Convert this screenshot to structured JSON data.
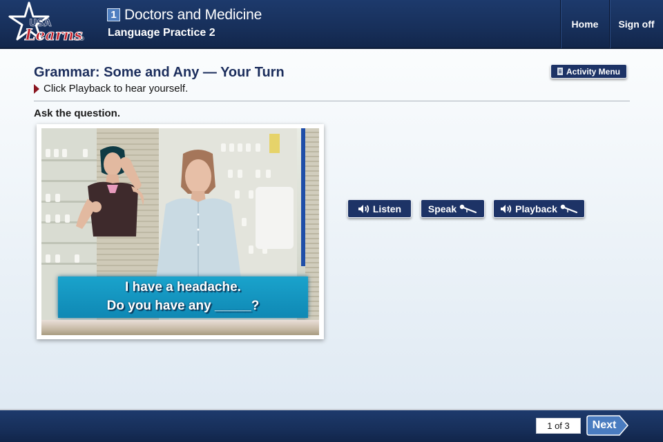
{
  "header": {
    "logo": {
      "line1": "USA",
      "line2": "Learns",
      "mark": "®"
    },
    "unit_number": "1",
    "unit_title": "Doctors and Medicine",
    "lesson_title": "Language Practice 2",
    "nav": [
      {
        "label": "Home"
      },
      {
        "label": "Sign off"
      }
    ]
  },
  "main": {
    "title": "Grammar: Some and Any — Your Turn",
    "instruction": "Click Playback to hear yourself.",
    "prompt": "Ask the question.",
    "activity_menu_label": "Activity Menu",
    "video": {
      "caption_line1": "I have a headache.",
      "caption_line2": "Do you have any _____?"
    },
    "buttons": {
      "listen": "Listen",
      "speak": "Speak",
      "playback": "Playback"
    }
  },
  "footer": {
    "page_indicator": "1 of 3",
    "next_label": "Next"
  },
  "colors": {
    "header_bg": "#1b3566",
    "button_bg": "#1d3366",
    "title_text": "#1b2d5c",
    "next_button": "#4a7cc0",
    "instruction_arrow": "#8a1620",
    "caption_band": "#1596c2"
  }
}
